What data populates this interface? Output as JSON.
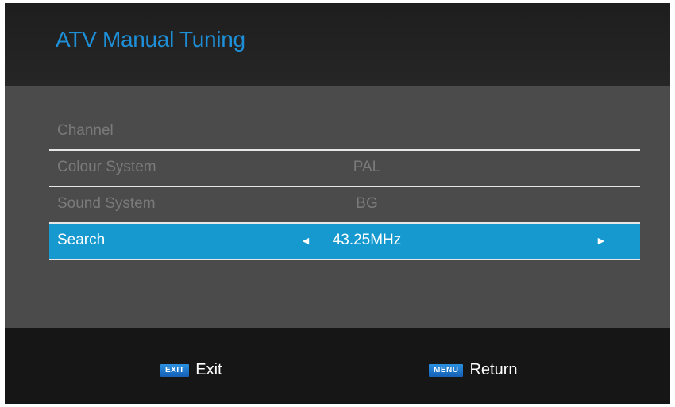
{
  "header": {
    "title": "ATV Manual Tuning"
  },
  "menu": {
    "rows": [
      {
        "label": "Channel",
        "value": ""
      },
      {
        "label": "Colour System",
        "value": "PAL"
      },
      {
        "label": "Sound System",
        "value": "BG"
      },
      {
        "label": "Search",
        "value": "43.25MHz",
        "selected": true
      }
    ]
  },
  "arrows": {
    "left": "◄",
    "right": "►"
  },
  "footer": {
    "exit": {
      "badge": "EXIT",
      "label": "Exit"
    },
    "menu": {
      "badge": "MENU",
      "label": "Return"
    }
  },
  "colors": {
    "accent": "#1e8fd6",
    "selected_row": "#1599cf",
    "panel": "#4b4b4b"
  }
}
